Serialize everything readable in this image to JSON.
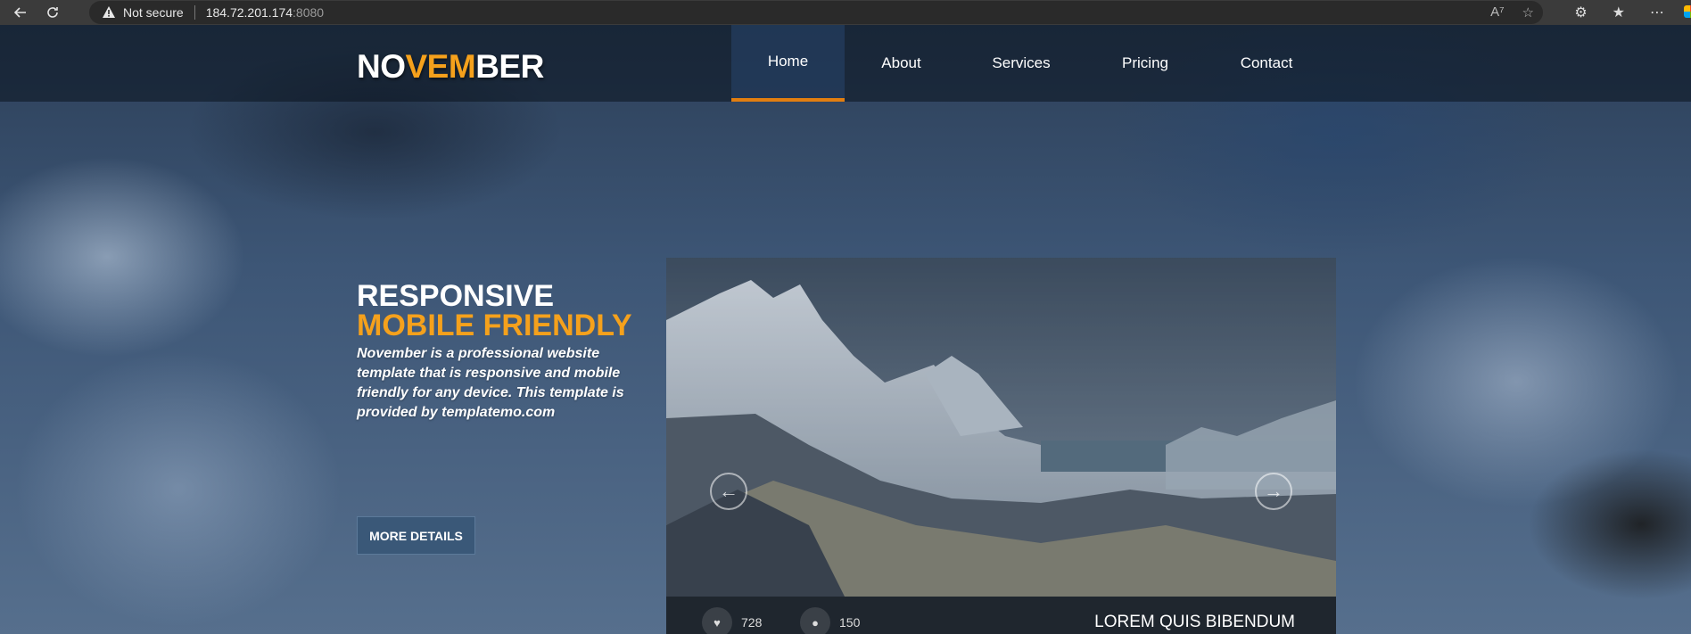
{
  "browser": {
    "security_label": "Not secure",
    "url_host": "184.72.201.174",
    "url_port": ":8080"
  },
  "site": {
    "logo_part1": "NO",
    "logo_part2": "VEM",
    "logo_part3": "BER",
    "nav": [
      {
        "label": "Home",
        "active": true
      },
      {
        "label": "About",
        "active": false
      },
      {
        "label": "Services",
        "active": false
      },
      {
        "label": "Pricing",
        "active": false
      },
      {
        "label": "Contact",
        "active": false
      }
    ]
  },
  "hero": {
    "title_line1": "RESPONSIVE",
    "title_line2": "MOBILE FRIENDLY",
    "description": "November is a professional website template that is responsive and mobile friendly for any device. This template is provided by templatemo.com",
    "button_label": "MORE DETAILS"
  },
  "slider": {
    "prev_icon": "arrow-left-circle-icon",
    "next_icon": "arrow-right-circle-icon",
    "likes": "728",
    "comments": "150",
    "caption_title": "LOREM QUIS BIBENDUM"
  },
  "colors": {
    "accent": "#f5a11c",
    "active_underline": "#e27e10"
  }
}
